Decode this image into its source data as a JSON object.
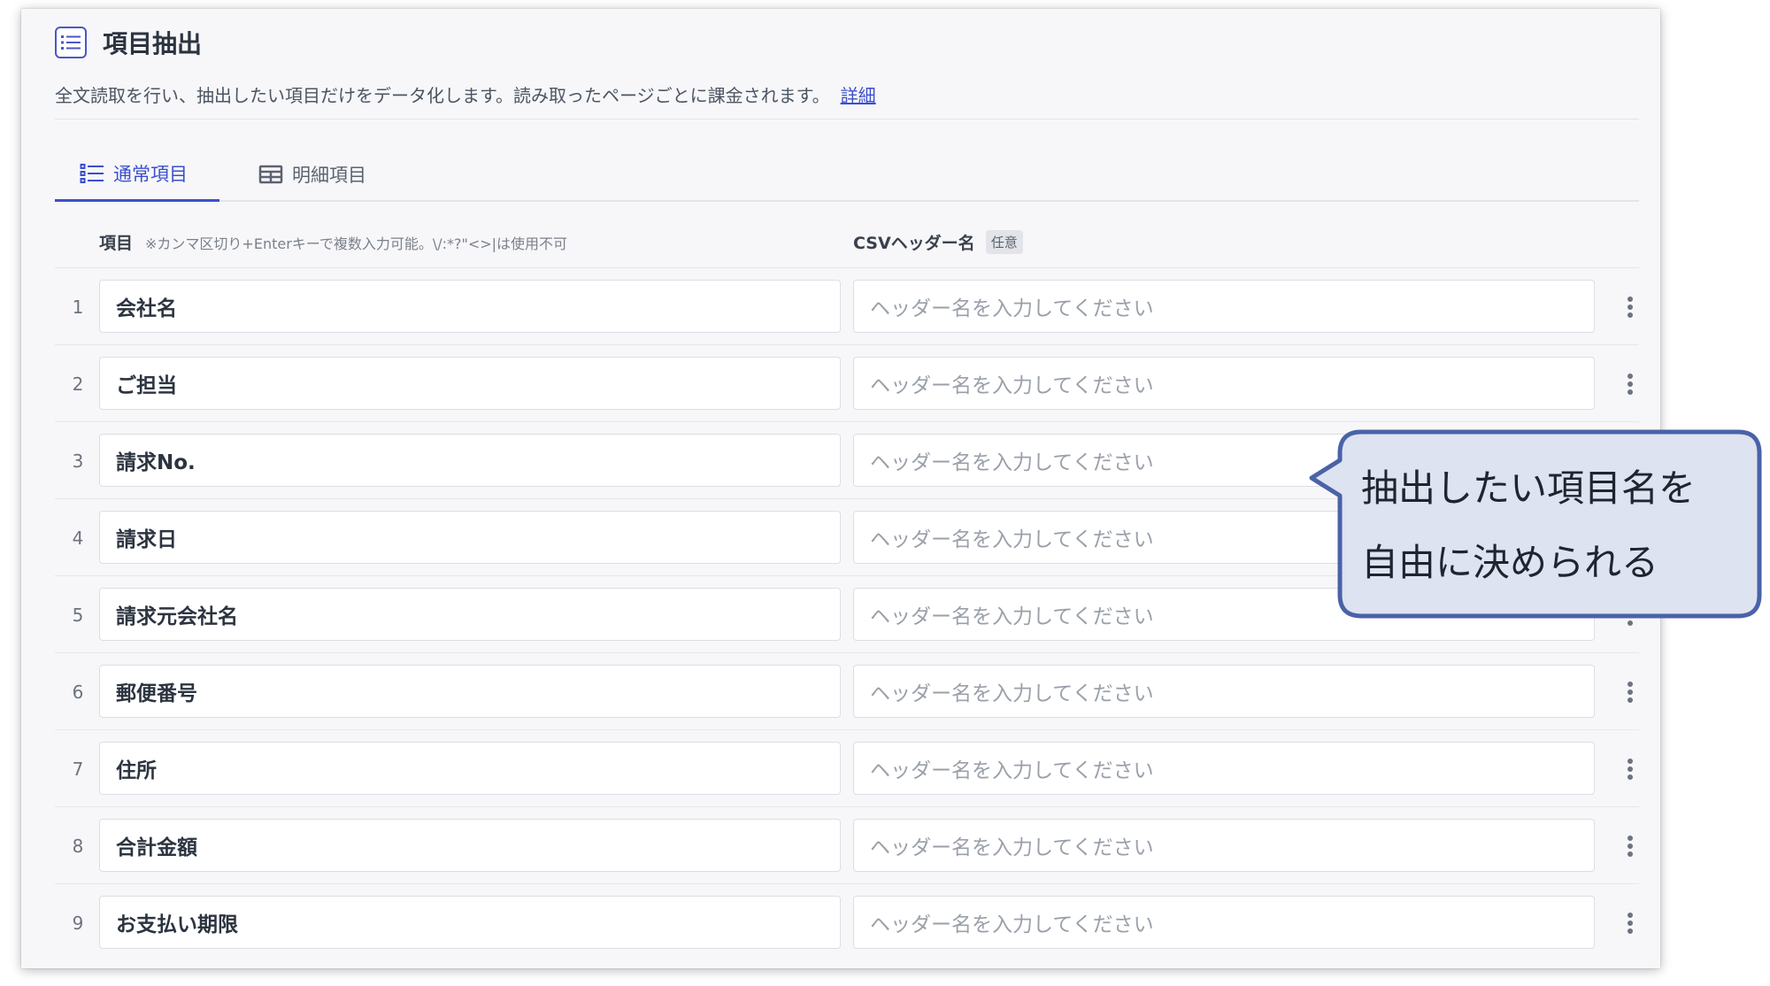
{
  "header": {
    "icon": "list-icon",
    "title": "項目抽出",
    "description": "全文読取を行い、抽出したい項目だけをデータ化します。読み取ったページごとに課金されます。",
    "detail_link": "詳細"
  },
  "tabs": [
    {
      "label": "通常項目",
      "icon": "list-icon",
      "active": true
    },
    {
      "label": "明細項目",
      "icon": "table-icon",
      "active": false
    }
  ],
  "columns": {
    "item_label": "項目",
    "item_note": "※カンマ区切り+Enterキーで複数入力可能。\\/:*?\"<>|は使用不可",
    "csv_label": "CSVヘッダー名",
    "csv_badge": "任意"
  },
  "rows": [
    {
      "num": "1",
      "item": "会社名",
      "placeholder": "ヘッダー名を入力してください"
    },
    {
      "num": "2",
      "item": "ご担当",
      "placeholder": "ヘッダー名を入力してください"
    },
    {
      "num": "3",
      "item": "請求No.",
      "placeholder": "ヘッダー名を入力してください"
    },
    {
      "num": "4",
      "item": "請求日",
      "placeholder": "ヘッダー名を入力してください"
    },
    {
      "num": "5",
      "item": "請求元会社名",
      "placeholder": "ヘッダー名を入力してください"
    },
    {
      "num": "6",
      "item": "郵便番号",
      "placeholder": "ヘッダー名を入力してください"
    },
    {
      "num": "7",
      "item": "住所",
      "placeholder": "ヘッダー名を入力してください"
    },
    {
      "num": "8",
      "item": "合計金額",
      "placeholder": "ヘッダー名を入力してください"
    },
    {
      "num": "9",
      "item": "お支払い期限",
      "placeholder": "ヘッダー名を入力してください"
    }
  ],
  "callout": {
    "line1": "抽出したい項目名を",
    "line2": "自由に決められる"
  },
  "colors": {
    "accent": "#3b4ecf",
    "callout_fill": "#dde3f0",
    "callout_border": "#4a62a8"
  }
}
